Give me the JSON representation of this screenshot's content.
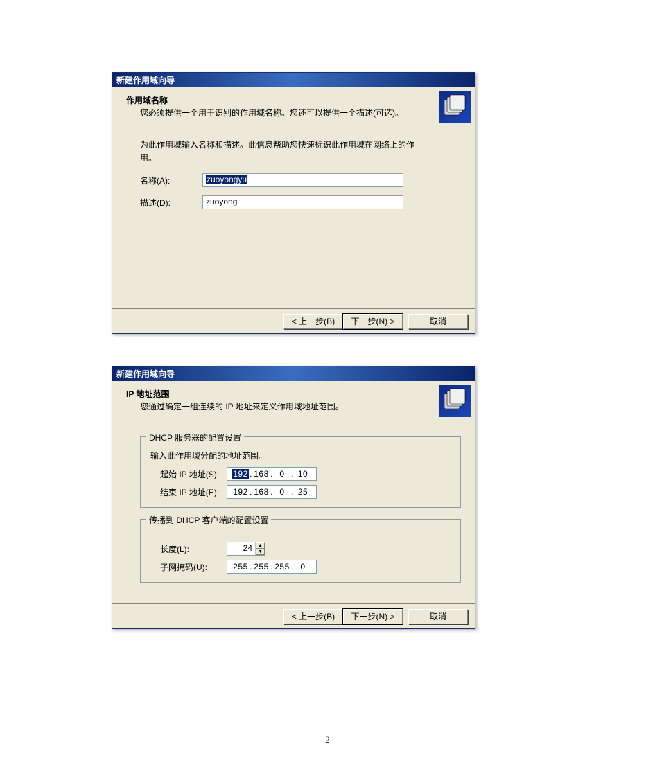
{
  "page_number": "2",
  "dialog1": {
    "title": "新建作用域向导",
    "header_title": "作用域名称",
    "header_sub": "您必须提供一个用于识别的作用域名称。您还可以提供一个描述(可选)。",
    "instruction": "为此作用域输入名称和描述。此信息帮助您快速标识此作用域在网络上的作用。",
    "name_label": "名称(A):",
    "name_value": "zuoyongyu",
    "desc_label": "描述(D):",
    "desc_value": "zuoyong",
    "back": "< 上一步(B)",
    "next": "下一步(N) >",
    "cancel": "取消"
  },
  "dialog2": {
    "title": "新建作用域向导",
    "header_title": "IP 地址范围",
    "header_sub": "您通过确定一组连续的 IP 地址来定义作用域地址范围。",
    "group1_legend": "DHCP 服务器的配置设置",
    "group1_instruction": "输入此作用域分配的地址范围。",
    "start_label": "起始 IP 地址(S):",
    "start_ip": {
      "o1": "192",
      "o2": "168",
      "o3": "0",
      "o4": "10"
    },
    "end_label": "结束 IP 地址(E):",
    "end_ip": {
      "o1": "192",
      "o2": "168",
      "o3": "0",
      "o4": "25"
    },
    "group2_legend": "传播到 DHCP 客户端的配置设置",
    "length_label": "长度(L):",
    "length_value": "24",
    "mask_label": "子网掩码(U):",
    "mask": {
      "o1": "255",
      "o2": "255",
      "o3": "255",
      "o4": "0"
    },
    "back": "< 上一步(B)",
    "next": "下一步(N) >",
    "cancel": "取消"
  }
}
